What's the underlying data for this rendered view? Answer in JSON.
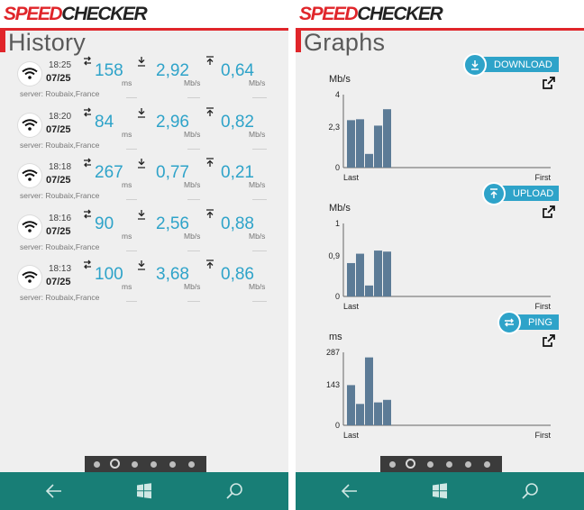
{
  "brand": {
    "speed": "SPEED",
    "checker": "CHECKER"
  },
  "history": {
    "title": "History",
    "entries": [
      {
        "time": "18:25",
        "date": "07/25",
        "ping": "158",
        "download": "2,92",
        "upload": "0,64",
        "server": "server: Roubaix,France"
      },
      {
        "time": "18:20",
        "date": "07/25",
        "ping": "84",
        "download": "2,96",
        "upload": "0,82",
        "server": "server: Roubaix,France"
      },
      {
        "time": "18:18",
        "date": "07/25",
        "ping": "267",
        "download": "0,77",
        "upload": "0,21",
        "server": "server: Roubaix,France"
      },
      {
        "time": "18:16",
        "date": "07/25",
        "ping": "90",
        "download": "2,56",
        "upload": "0,88",
        "server": "server: Roubaix,France"
      },
      {
        "time": "18:13",
        "date": "07/25",
        "ping": "100",
        "download": "3,68",
        "upload": "0,86",
        "server": "server: Roubaix,France"
      }
    ],
    "units": {
      "ping": "ms",
      "speed": "Mb/s"
    }
  },
  "graphs": {
    "title": "Graphs",
    "download_label": "DOWNLOAD",
    "upload_label": "UPLOAD",
    "ping_label": "PING"
  },
  "chart_data": [
    {
      "type": "bar",
      "unit_label": "Mb/s",
      "yticks": [
        "4",
        "2,3",
        "0"
      ],
      "ylim": [
        0,
        4
      ],
      "x_start": "Last",
      "x_end": "First",
      "values": [
        2.6,
        2.65,
        0.75,
        2.3,
        3.2
      ]
    },
    {
      "type": "bar",
      "unit_label": "Mb/s",
      "yticks": [
        "1",
        "0,9",
        "0"
      ],
      "ylim": [
        0,
        1.4
      ],
      "x_start": "Last",
      "x_end": "First",
      "values": [
        0.64,
        0.82,
        0.21,
        0.88,
        0.86
      ]
    },
    {
      "type": "bar",
      "unit_label": "ms",
      "yticks": [
        "287",
        "143",
        "0"
      ],
      "ylim": [
        0,
        287
      ],
      "x_start": "Last",
      "x_end": "First",
      "values": [
        158,
        84,
        267,
        90,
        100
      ]
    }
  ],
  "pager": {
    "count": 6,
    "active": 1
  },
  "colors": {
    "accent": "#2ea3c9",
    "brand_red": "#e0252a",
    "navbar": "#187e76",
    "bar": "#5c7b96"
  }
}
